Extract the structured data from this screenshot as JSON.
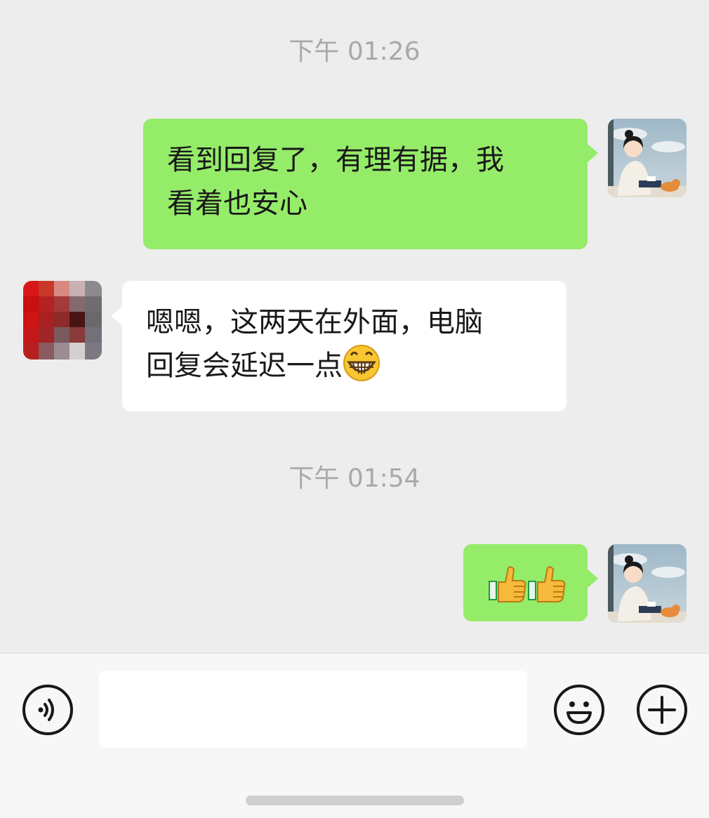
{
  "messages": [
    {
      "type": "time",
      "text": "下午 01:26"
    },
    {
      "type": "msg",
      "from": "me",
      "lines": [
        "看到回复了，有理有据，我",
        "看着也安心"
      ]
    },
    {
      "type": "msg",
      "from": "other",
      "lines": [
        "嗯嗯，这两天在外面，电脑",
        "回复会延迟一点"
      ],
      "emoji": "grinning-face"
    },
    {
      "type": "time",
      "text": "下午 01:54"
    },
    {
      "type": "msg",
      "from": "me",
      "emoji": [
        "thumbs-up",
        "thumbs-up"
      ]
    }
  ],
  "input_bar": {
    "voice_icon": "voice-icon",
    "emoji_icon": "emoji-icon",
    "plus_icon": "plus-icon",
    "text_value": ""
  },
  "colors": {
    "chat_bg": "#ededed",
    "my_bubble": "#95ec69",
    "their_bubble": "#ffffff",
    "timestamp": "#a9a9a9",
    "input_bar_bg": "#f7f7f7"
  }
}
